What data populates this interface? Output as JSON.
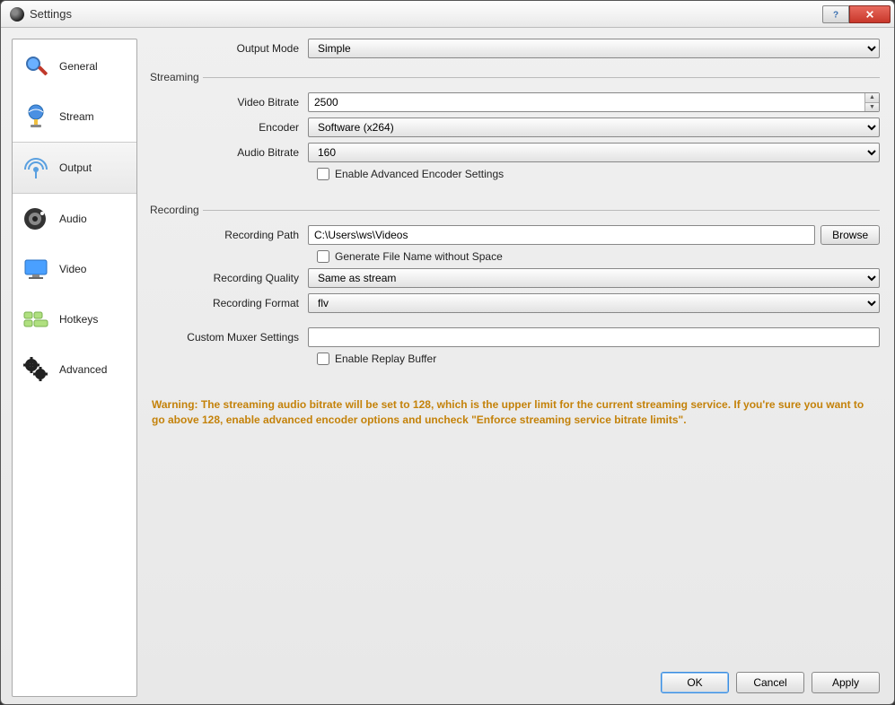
{
  "window": {
    "title": "Settings"
  },
  "sidebar": {
    "items": [
      {
        "label": "General"
      },
      {
        "label": "Stream"
      },
      {
        "label": "Output"
      },
      {
        "label": "Audio"
      },
      {
        "label": "Video"
      },
      {
        "label": "Hotkeys"
      },
      {
        "label": "Advanced"
      }
    ],
    "selected": "Output"
  },
  "output": {
    "mode_label": "Output Mode",
    "mode_value": "Simple"
  },
  "streaming": {
    "legend": "Streaming",
    "video_bitrate_label": "Video Bitrate",
    "video_bitrate_value": "2500",
    "encoder_label": "Encoder",
    "encoder_value": "Software (x264)",
    "audio_bitrate_label": "Audio Bitrate",
    "audio_bitrate_value": "160",
    "enable_advanced_label": "Enable Advanced Encoder Settings",
    "enable_advanced_checked": false
  },
  "recording": {
    "legend": "Recording",
    "path_label": "Recording Path",
    "path_value": "C:\\Users\\ws\\Videos",
    "browse_label": "Browse",
    "gen_filename_label": "Generate File Name without Space",
    "gen_filename_checked": false,
    "quality_label": "Recording Quality",
    "quality_value": "Same as stream",
    "format_label": "Recording Format",
    "format_value": "flv",
    "muxer_label": "Custom Muxer Settings",
    "muxer_value": "",
    "replay_buffer_label": "Enable Replay Buffer",
    "replay_buffer_checked": false
  },
  "warning_text": "Warning: The streaming audio bitrate will be set to 128, which is the upper limit for the current streaming service.  If you're sure you want to go above 128, enable advanced encoder options and uncheck \"Enforce streaming service bitrate limits\".",
  "footer": {
    "ok": "OK",
    "cancel": "Cancel",
    "apply": "Apply"
  }
}
